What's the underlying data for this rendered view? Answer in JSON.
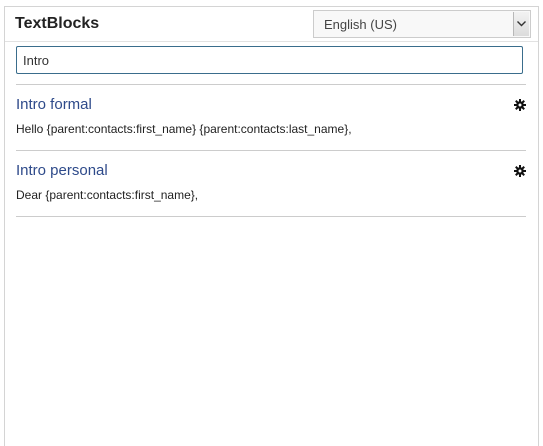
{
  "header": {
    "title": "TextBlocks",
    "language": {
      "selected": "English (US)"
    }
  },
  "search": {
    "value": "Intro"
  },
  "textblocks": [
    {
      "title": "Intro formal",
      "content": "Hello {parent:contacts:first_name} {parent:contacts:last_name},",
      "settings_icon": "gear-icon"
    },
    {
      "title": "Intro personal",
      "content": "Dear {parent:contacts:first_name},",
      "settings_icon": "gear-icon"
    }
  ],
  "colors": {
    "title_link": "#2e4a8a",
    "search_border": "#3a6d8c",
    "divider": "#cccccc"
  }
}
